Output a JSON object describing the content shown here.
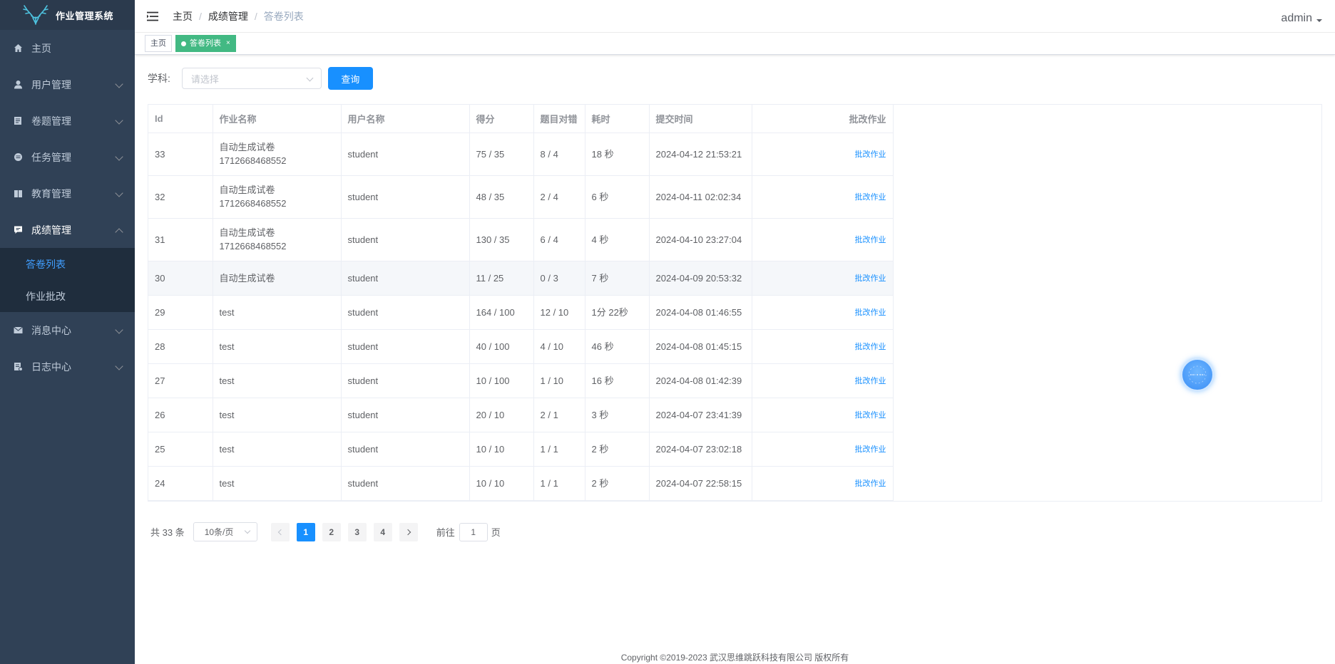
{
  "sidebar": {
    "logo_text": "作业管理系统",
    "menu": [
      {
        "label": "主页",
        "icon": "home-icon"
      },
      {
        "label": "用户管理",
        "icon": "user-icon"
      },
      {
        "label": "卷题管理",
        "icon": "document-icon"
      },
      {
        "label": "任务管理",
        "icon": "task-icon"
      },
      {
        "label": "教育管理",
        "icon": "book-icon"
      },
      {
        "label": "成绩管理",
        "icon": "message-icon"
      },
      {
        "label": "消息中心",
        "icon": "mail-icon"
      },
      {
        "label": "日志中心",
        "icon": "log-icon"
      }
    ],
    "submenu": [
      {
        "label": "答卷列表"
      },
      {
        "label": "作业批改"
      }
    ]
  },
  "header": {
    "breadcrumb": [
      "主页",
      "成绩管理",
      "答卷列表"
    ],
    "user": "admin"
  },
  "tags": {
    "home": "主页",
    "active": "答卷列表",
    "close": "×"
  },
  "filter": {
    "label": "学科:",
    "placeholder": "请选择",
    "query_button": "查询"
  },
  "table": {
    "headers": [
      "Id",
      "作业名称",
      "用户名称",
      "得分",
      "题目对错",
      "耗时",
      "提交时间",
      "批改作业"
    ],
    "rows": [
      {
        "id": "33",
        "name": "自动生成试卷1712668468552",
        "user": "student",
        "score": "75 / 35",
        "correct": "8 / 4",
        "time": "18 秒",
        "submit": "2024-04-12 21:53:21",
        "action": "批改作业"
      },
      {
        "id": "32",
        "name": "自动生成试卷1712668468552",
        "user": "student",
        "score": "48 / 35",
        "correct": "2 / 4",
        "time": "6 秒",
        "submit": "2024-04-11 02:02:34",
        "action": "批改作业"
      },
      {
        "id": "31",
        "name": "自动生成试卷1712668468552",
        "user": "student",
        "score": "130 / 35",
        "correct": "6 / 4",
        "time": "4 秒",
        "submit": "2024-04-10 23:27:04",
        "action": "批改作业"
      },
      {
        "id": "30",
        "name": "自动生成试卷",
        "user": "student",
        "score": "11 / 25",
        "correct": "0 / 3",
        "time": "7 秒",
        "submit": "2024-04-09 20:53:32",
        "action": "批改作业"
      },
      {
        "id": "29",
        "name": "test",
        "user": "student",
        "score": "164 / 100",
        "correct": "12 / 10",
        "time": "1分 22秒",
        "submit": "2024-04-08 01:46:55",
        "action": "批改作业"
      },
      {
        "id": "28",
        "name": "test",
        "user": "student",
        "score": "40 / 100",
        "correct": "4 / 10",
        "time": "46 秒",
        "submit": "2024-04-08 01:45:15",
        "action": "批改作业"
      },
      {
        "id": "27",
        "name": "test",
        "user": "student",
        "score": "10 / 100",
        "correct": "1 / 10",
        "time": "16 秒",
        "submit": "2024-04-08 01:42:39",
        "action": "批改作业"
      },
      {
        "id": "26",
        "name": "test",
        "user": "student",
        "score": "20 / 10",
        "correct": "2 / 1",
        "time": "3 秒",
        "submit": "2024-04-07 23:41:39",
        "action": "批改作业"
      },
      {
        "id": "25",
        "name": "test",
        "user": "student",
        "score": "10 / 10",
        "correct": "1 / 1",
        "time": "2 秒",
        "submit": "2024-04-07 23:02:18",
        "action": "批改作业"
      },
      {
        "id": "24",
        "name": "test",
        "user": "student",
        "score": "10 / 10",
        "correct": "1 / 1",
        "time": "2 秒",
        "submit": "2024-04-07 22:58:15",
        "action": "批改作业"
      }
    ]
  },
  "pagination": {
    "total": "共 33 条",
    "page_size": "10条/页",
    "pages": [
      "1",
      "2",
      "3",
      "4"
    ],
    "goto_prefix": "前往",
    "goto_value": "1",
    "goto_suffix": "页"
  },
  "footer": "Copyright ©2019-2023 武汉思维跳跃科技有限公司 版权所有",
  "colors": {
    "sidebar_bg": "#304156",
    "accent": "#1890ff",
    "tag_active": "#42b983"
  }
}
